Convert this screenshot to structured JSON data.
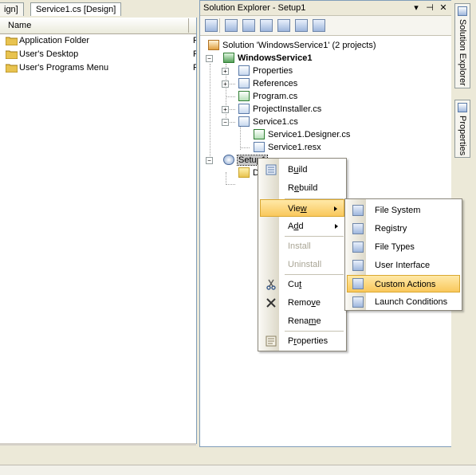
{
  "left": {
    "tabs": [
      {
        "label": "ign]"
      },
      {
        "label": "Service1.cs [Design]"
      }
    ],
    "column_header": "Name",
    "folders": [
      {
        "label": "Application Folder",
        "trail": "F"
      },
      {
        "label": "User's Desktop",
        "trail": "F"
      },
      {
        "label": "User's Programs Menu",
        "trail": "F"
      }
    ]
  },
  "solution_explorer": {
    "title": "Solution Explorer - Setup1",
    "title_buttons": {
      "dropdown": "▾",
      "pin": "⊣",
      "close": "✕"
    },
    "tree": [
      {
        "label": "Solution 'WindowsService1' (2 projects)",
        "icon": "solution-icon"
      },
      {
        "label": "WindowsService1",
        "icon": "csharp-project-icon",
        "expander": "−"
      },
      {
        "label": "Properties",
        "icon": "properties-icon",
        "expander": "+"
      },
      {
        "label": "References",
        "icon": "references-icon",
        "expander": "+"
      },
      {
        "label": "Program.cs",
        "icon": "csharp-file-icon"
      },
      {
        "label": "ProjectInstaller.cs",
        "icon": "component-icon",
        "expander": "+"
      },
      {
        "label": "Service1.cs",
        "icon": "component-icon",
        "expander": "−"
      },
      {
        "label": "Service1.Designer.cs",
        "icon": "csharp-file-icon"
      },
      {
        "label": "Service1.resx",
        "icon": "resx-icon"
      },
      {
        "label": "Setup1",
        "icon": "setup-project-icon",
        "expander": "−"
      },
      {
        "label": "D",
        "icon": "folder-icon"
      }
    ]
  },
  "side_tabs": [
    {
      "label": "Solution Explorer"
    },
    {
      "label": "Properties"
    }
  ],
  "context_menu": {
    "items": [
      {
        "label": "Build",
        "u": "u",
        "icon": "build-icon"
      },
      {
        "label": "Rebuild",
        "u": "e"
      },
      {
        "label": "View",
        "u": "w",
        "submenu": true,
        "highlighted": true
      },
      {
        "label": "Add",
        "u": "d",
        "submenu": true
      },
      {
        "label": "Install",
        "disabled": true
      },
      {
        "label": "Uninstall",
        "disabled": true
      },
      {
        "label": "Cut",
        "u": "t",
        "icon": "scissors-icon"
      },
      {
        "label": "Remove",
        "u": "v",
        "icon": "delete-x-icon"
      },
      {
        "label": "Rename",
        "u": "m"
      },
      {
        "label": "Properties",
        "u": "r",
        "icon": "properties-icon"
      }
    ]
  },
  "view_submenu": {
    "items": [
      {
        "label": "File System",
        "icon": "file-system-editor-icon"
      },
      {
        "label": "Registry",
        "icon": "registry-editor-icon"
      },
      {
        "label": "File Types",
        "icon": "file-types-editor-icon"
      },
      {
        "label": "User Interface",
        "icon": "user-interface-editor-icon"
      },
      {
        "label": "Custom Actions",
        "icon": "custom-actions-editor-icon",
        "highlighted": true
      },
      {
        "label": "Launch Conditions",
        "icon": "launch-conditions-editor-icon"
      }
    ]
  },
  "colors": {
    "chrome": "#ece9d8",
    "menu_highlight": "#f9c85c",
    "selection": "#c7c7c7",
    "border": "#7f9db9"
  }
}
